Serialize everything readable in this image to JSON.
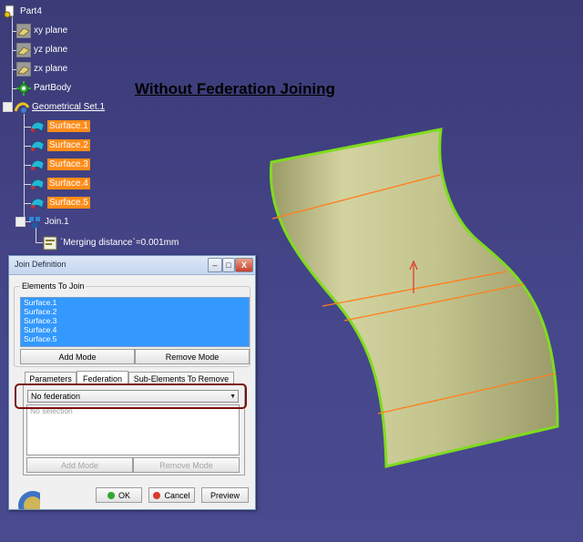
{
  "tree": {
    "root": "Part4",
    "planes": [
      "xy plane",
      "yz plane",
      "zx plane"
    ],
    "body": "PartBody",
    "geo_set": "Geometrical Set.1",
    "surfaces": [
      "Surface.1",
      "Surface.2",
      "Surface.3",
      "Surface.4",
      "Surface.5"
    ],
    "join": "Join.1",
    "param": "`Merging distance`=0.001mm"
  },
  "annotation": {
    "title": "Without Federation Joining"
  },
  "dialog": {
    "title": "Join Definition",
    "minimize": "–",
    "maximize": "□",
    "close": "X",
    "elements_group": "Elements To Join",
    "elements": [
      "Surface.1",
      "Surface.2",
      "Surface.3",
      "Surface.4",
      "Surface.5"
    ],
    "add_mode": "Add Mode",
    "remove_mode": "Remove Mode",
    "tabs": [
      "Parameters",
      "Federation",
      "Sub-Elements To Remove"
    ],
    "federation_value": "No federation",
    "no_selection": "No selection",
    "add_mode2": "Add Mode",
    "remove_mode2": "Remove Mode",
    "ok": "OK",
    "cancel": "Cancel",
    "preview": "Preview"
  },
  "colors": {
    "viewport": "#45458a",
    "surface_fill": "#bdbd86",
    "surface_edge": "#7fdc1e",
    "section_line": "#ff7f1a",
    "highlight": "#ff8c1a",
    "selection": "#3399ff",
    "callout": "#7a1010"
  }
}
